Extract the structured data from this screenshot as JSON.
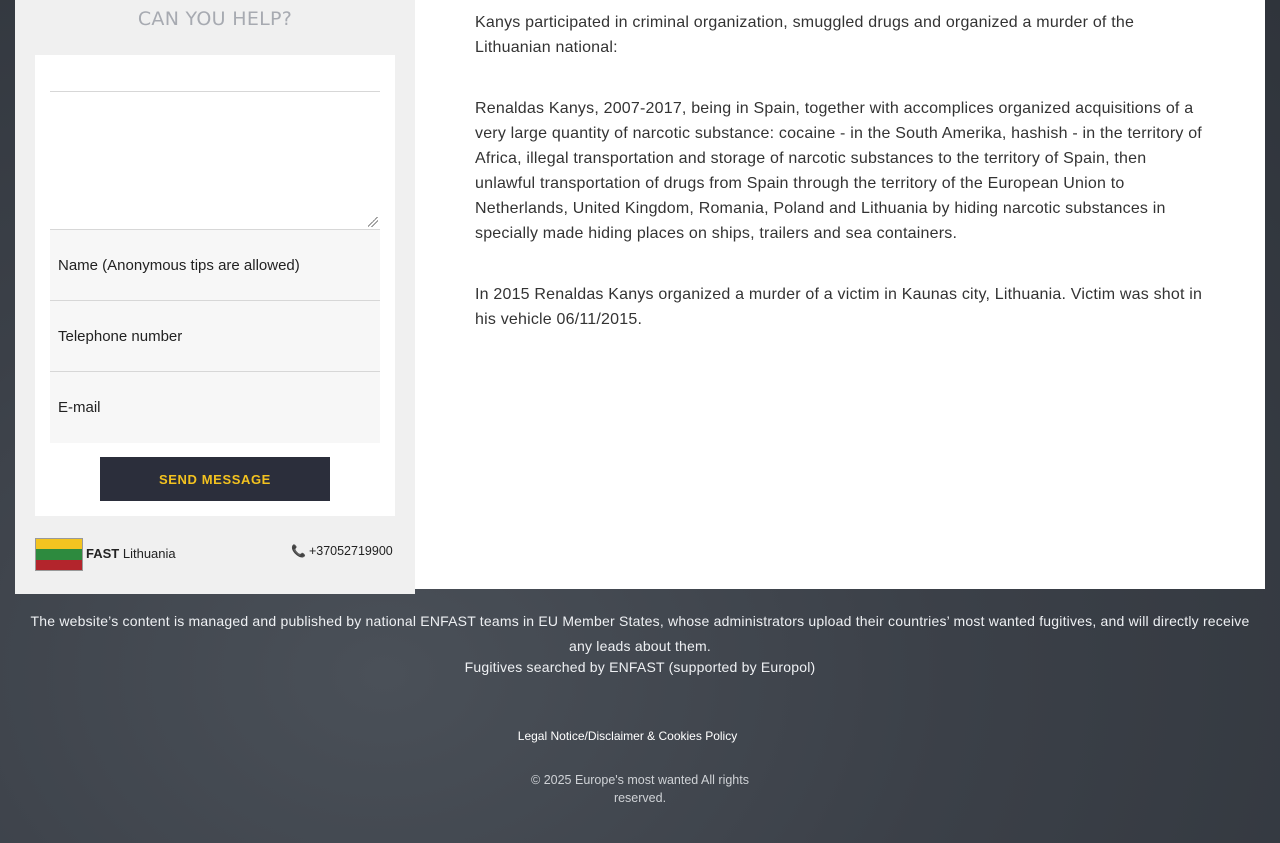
{
  "sidebar": {
    "title": "CAN YOU HELP?",
    "form": {
      "message_placeholder": "",
      "name_placeholder": "Name (Anonymous tips are allowed)",
      "phone_placeholder": "Telephone number",
      "email_placeholder": "E-mail",
      "send_label": "SEND MESSAGE"
    },
    "contact": {
      "flag_icon": "lithuania-flag-icon",
      "team_bold": "FAST",
      "team_country": "Lithuania",
      "phone_icon": "telephone-icon",
      "phone_number": "+37052719900"
    }
  },
  "content": {
    "paragraphs": [
      "Kanys participated in criminal organization, smuggled drugs and organized a murder of the Lithuanian national:",
      "Renaldas Kanys, 2007-2017, being in Spain, together with accomplices organized acquisitions of a very large quantity of narcotic substance: cocaine - in the South Amerika, hashish - in the territory of Africa, illegal transportation and storage of narcotic substances to the territory of Spain, then unlawful transportation of drugs from Spain through the territory of the European Union to Netherlands, United Kingdom, Romania, Poland and Lithuania by hiding narcotic substances in specially made hiding places on ships, trailers and sea containers.",
      "In 2015 Renaldas Kanys organized a murder of a victim in Kaunas city, Lithuania. Victim was shot in his vehicle 06/11/2015."
    ]
  },
  "footer": {
    "managed_text": "The website’s content is managed and published by national ENFAST teams in EU Member States, whose administrators upload their countries’ most wanted fugitives, and will directly receive any leads about them.",
    "searched_text": "Fugitives searched by ENFAST (supported by Europol)",
    "legal_link": "Legal Notice/Disclaimer & Cookies Policy",
    "copyright": "© 2025 Europe's most wanted All rights reserved."
  },
  "colors": {
    "button_bg": "#2b2e3b",
    "button_text": "#f3c21f",
    "flag_yellow": "#f3c420",
    "flag_green": "#2d8a3e",
    "flag_red": "#b3252c"
  }
}
